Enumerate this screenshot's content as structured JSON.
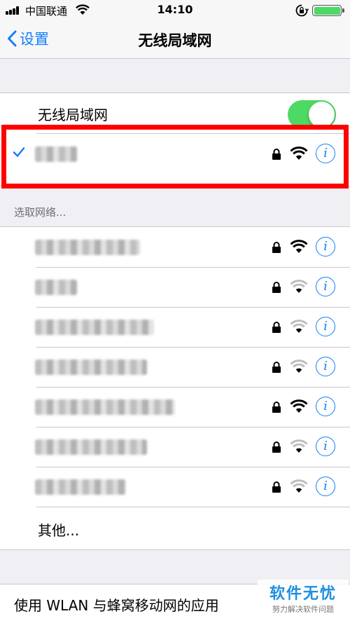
{
  "status_bar": {
    "carrier": "中国联通",
    "time": "14:10",
    "battery_color": "#4cd964",
    "icons": [
      "signal-icon",
      "wifi-icon",
      "orientation-lock-icon",
      "battery-icon"
    ]
  },
  "nav": {
    "back_label": "设置",
    "title": "无线局域网",
    "accent": "#157efb"
  },
  "wifi_toggle": {
    "label": "无线局域网",
    "on": true,
    "color": "#4cd964"
  },
  "connected_network": {
    "secured": true,
    "signal": "full"
  },
  "section_header": "选取网络...",
  "networks": [
    {
      "secured": true,
      "signal": "full"
    },
    {
      "secured": true,
      "signal": "weak"
    },
    {
      "secured": true,
      "signal": "weak"
    },
    {
      "secured": true,
      "signal": "weak"
    },
    {
      "secured": true,
      "signal": "full"
    },
    {
      "secured": true,
      "signal": "weak"
    },
    {
      "secured": true,
      "signal": "weak"
    }
  ],
  "other_label": "其他...",
  "wlan_apps_label": "使用 WLAN 与蜂窝移动网的应用",
  "watermark": {
    "title": "软件无忧",
    "subtitle": "努力解决软件问题"
  }
}
